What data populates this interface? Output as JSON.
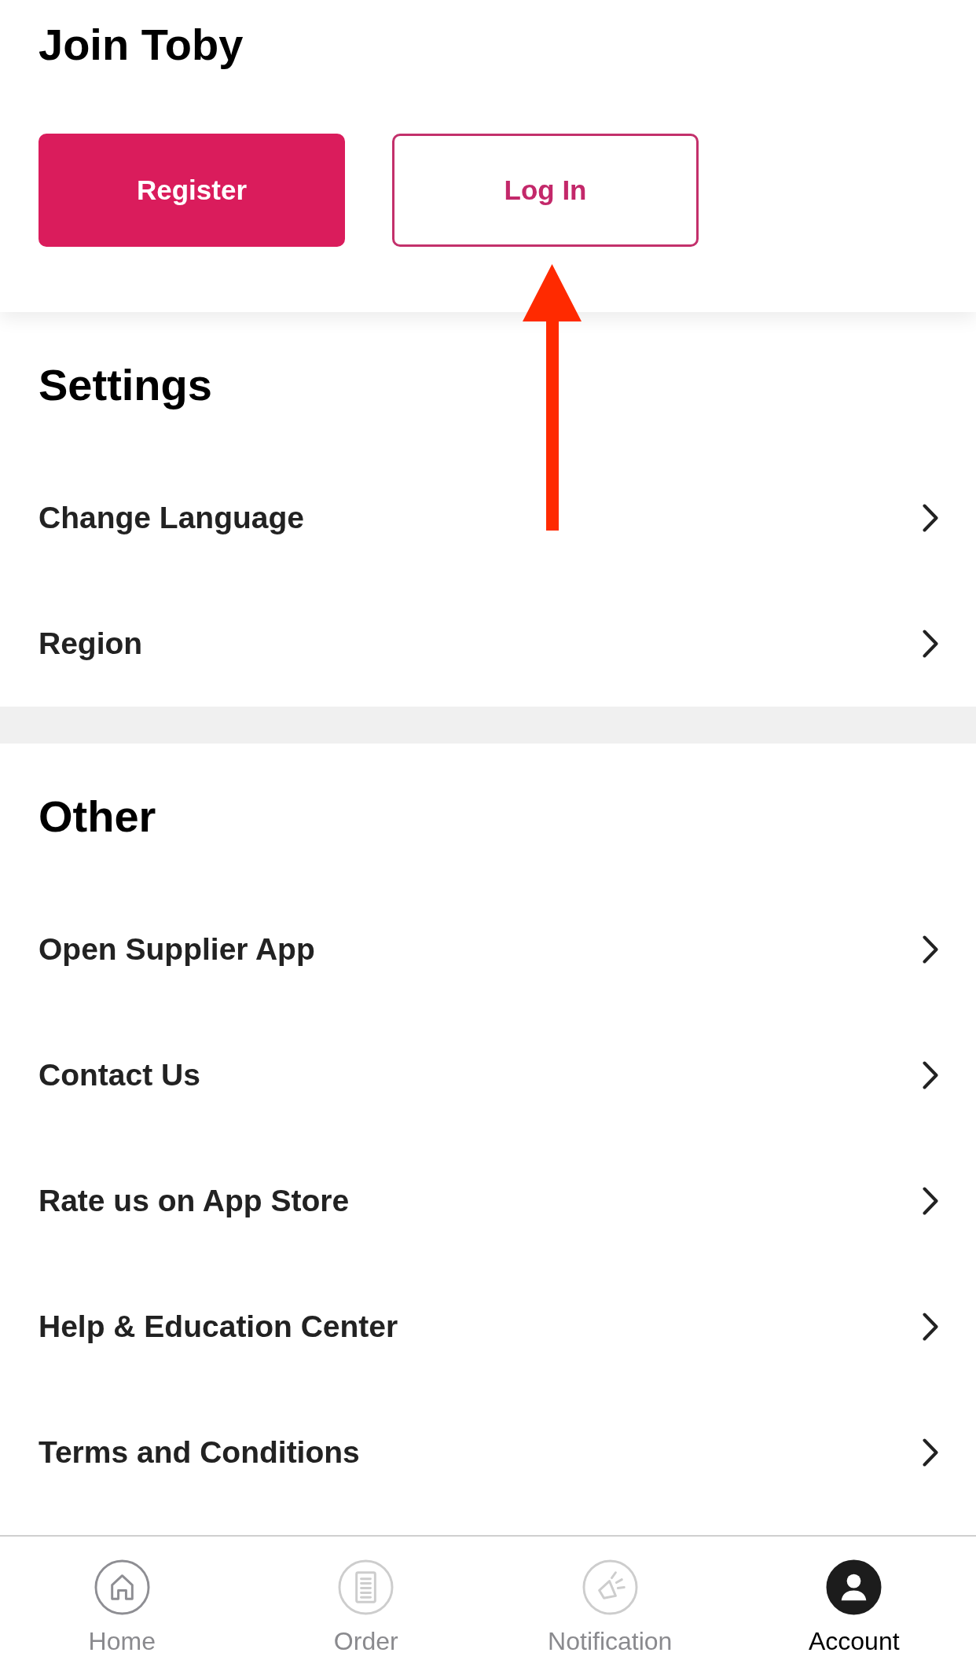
{
  "header": {
    "title": "Join Toby",
    "buttons": [
      {
        "label": "Register",
        "kind": "primary"
      },
      {
        "label": "Log In",
        "kind": "outline"
      }
    ]
  },
  "sections": [
    {
      "title": "Settings",
      "items": [
        {
          "label": "Change Language"
        },
        {
          "label": "Region"
        }
      ]
    },
    {
      "title": "Other",
      "items": [
        {
          "label": "Open Supplier App"
        },
        {
          "label": "Contact Us"
        },
        {
          "label": "Rate us on App Store"
        },
        {
          "label": "Help & Education Center"
        },
        {
          "label": "Terms and Conditions"
        }
      ]
    }
  ],
  "tab_bar": {
    "tabs": [
      {
        "label": "Home",
        "selected": false
      },
      {
        "label": "Order",
        "selected": false
      },
      {
        "label": "Notification",
        "selected": false
      },
      {
        "label": "Account",
        "selected": true
      }
    ]
  }
}
